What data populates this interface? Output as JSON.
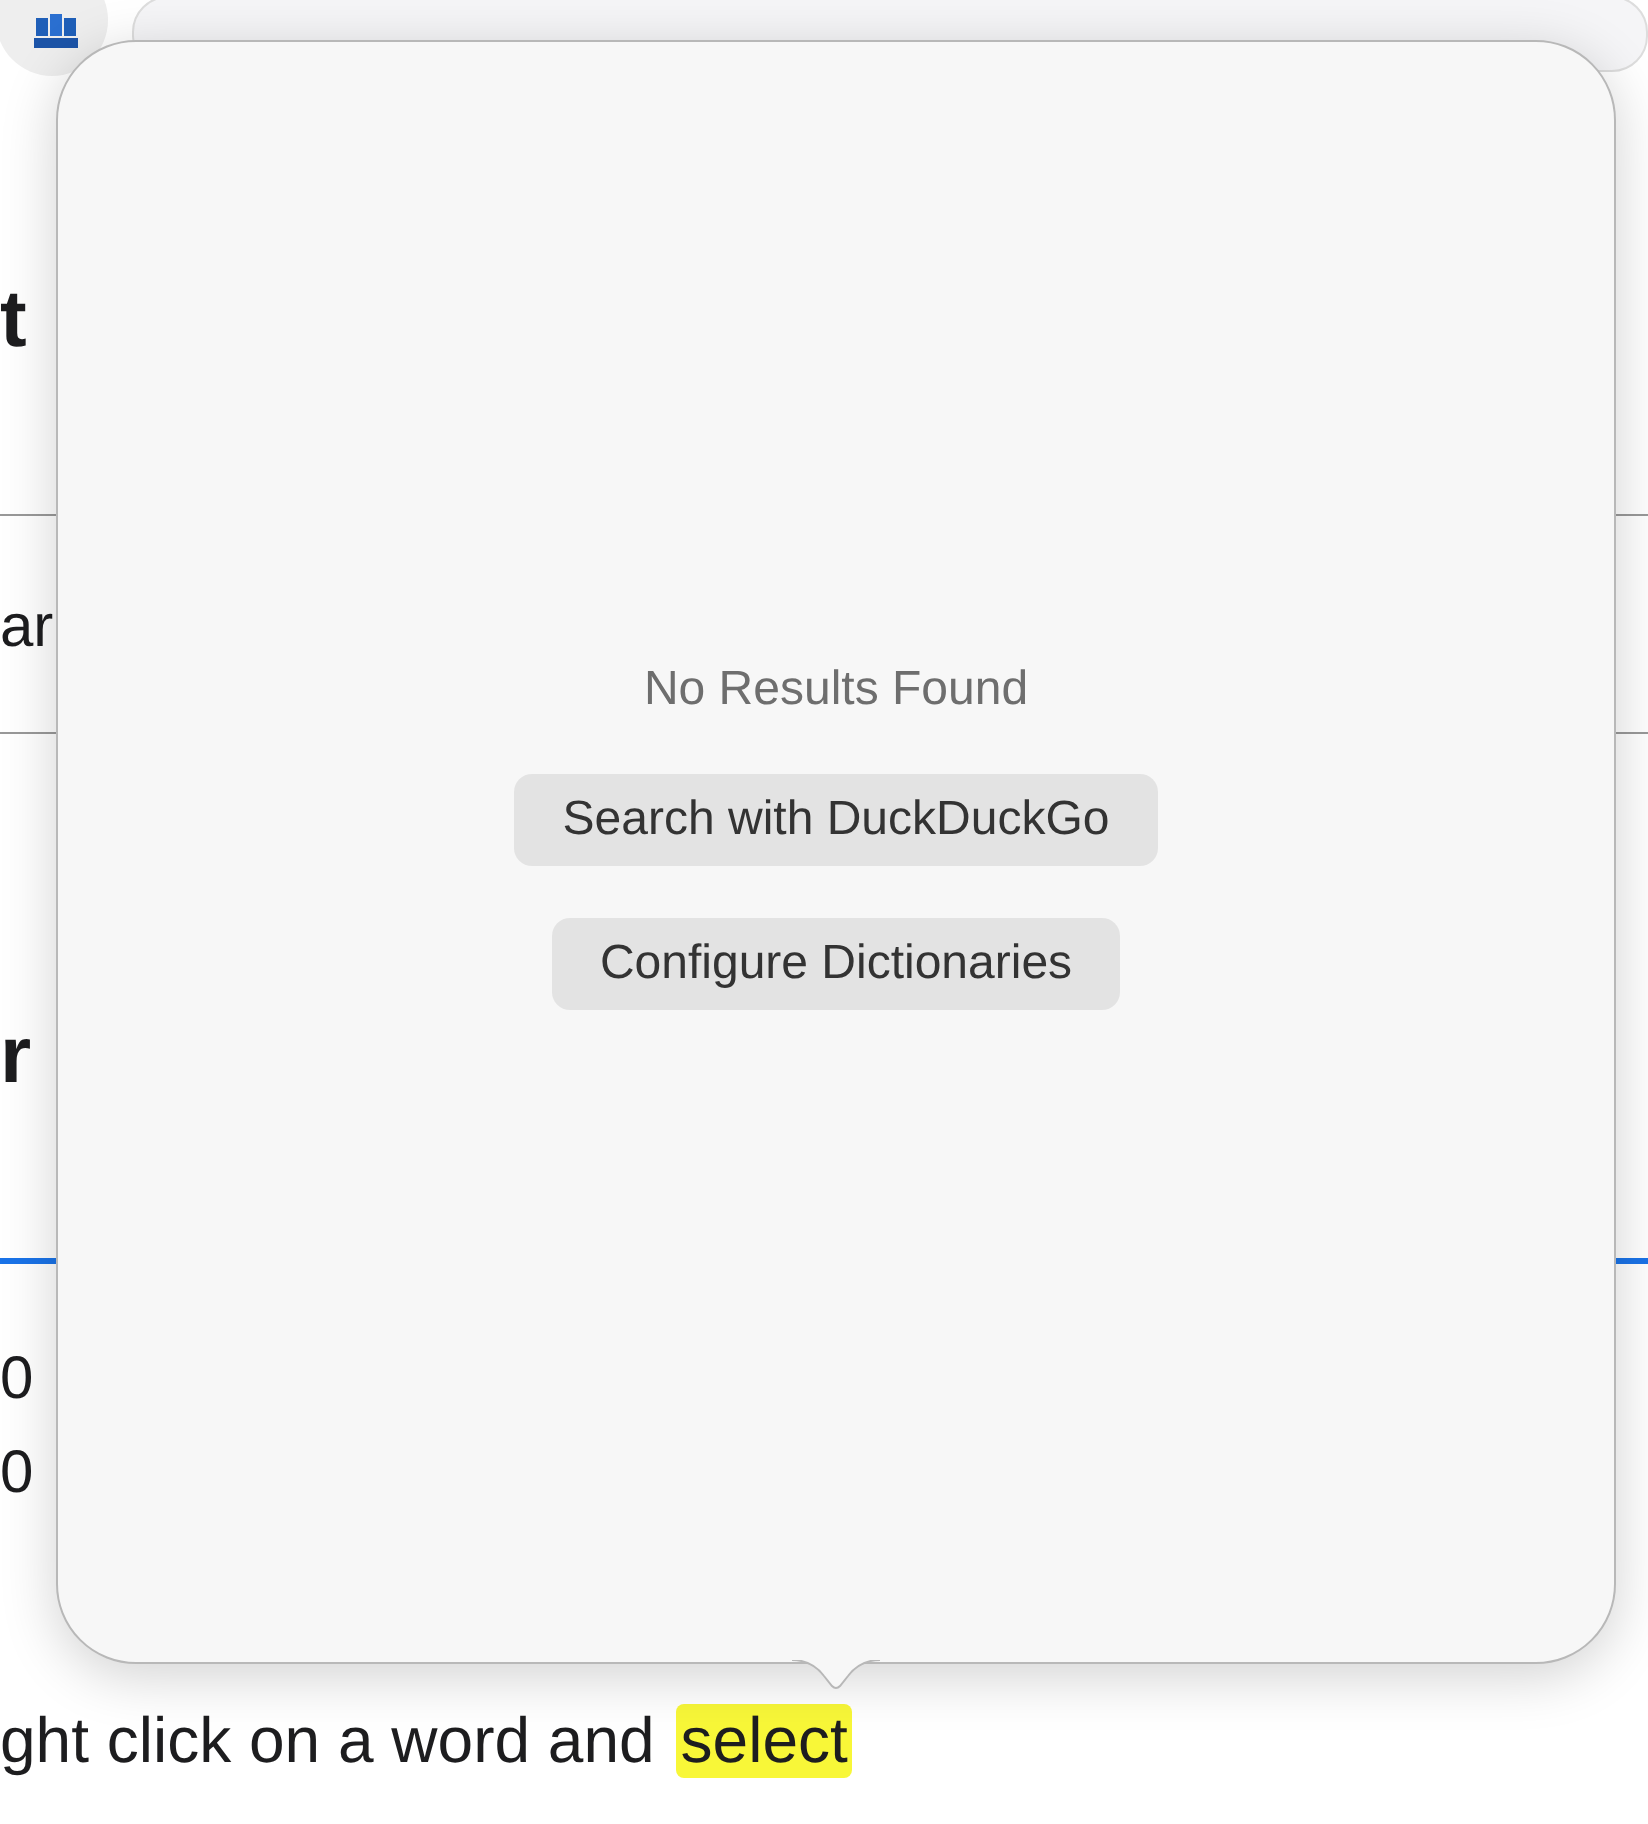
{
  "page": {
    "fragments": [
      {
        "kind": "heading",
        "text": "t"
      },
      {
        "kind": "body",
        "text": "ar"
      },
      {
        "kind": "heading",
        "text": "r"
      },
      {
        "kind": "number",
        "text": "0"
      },
      {
        "kind": "number",
        "text": "0"
      }
    ],
    "sentence": [
      {
        "text": "ght click on a word and",
        "highlighted": false
      },
      {
        "text": "select",
        "highlighted": true
      }
    ]
  },
  "popover": {
    "message": "No Results Found",
    "buttons": [
      {
        "label": "Search with DuckDuckGo"
      },
      {
        "label": "Configure Dictionaries"
      }
    ]
  }
}
